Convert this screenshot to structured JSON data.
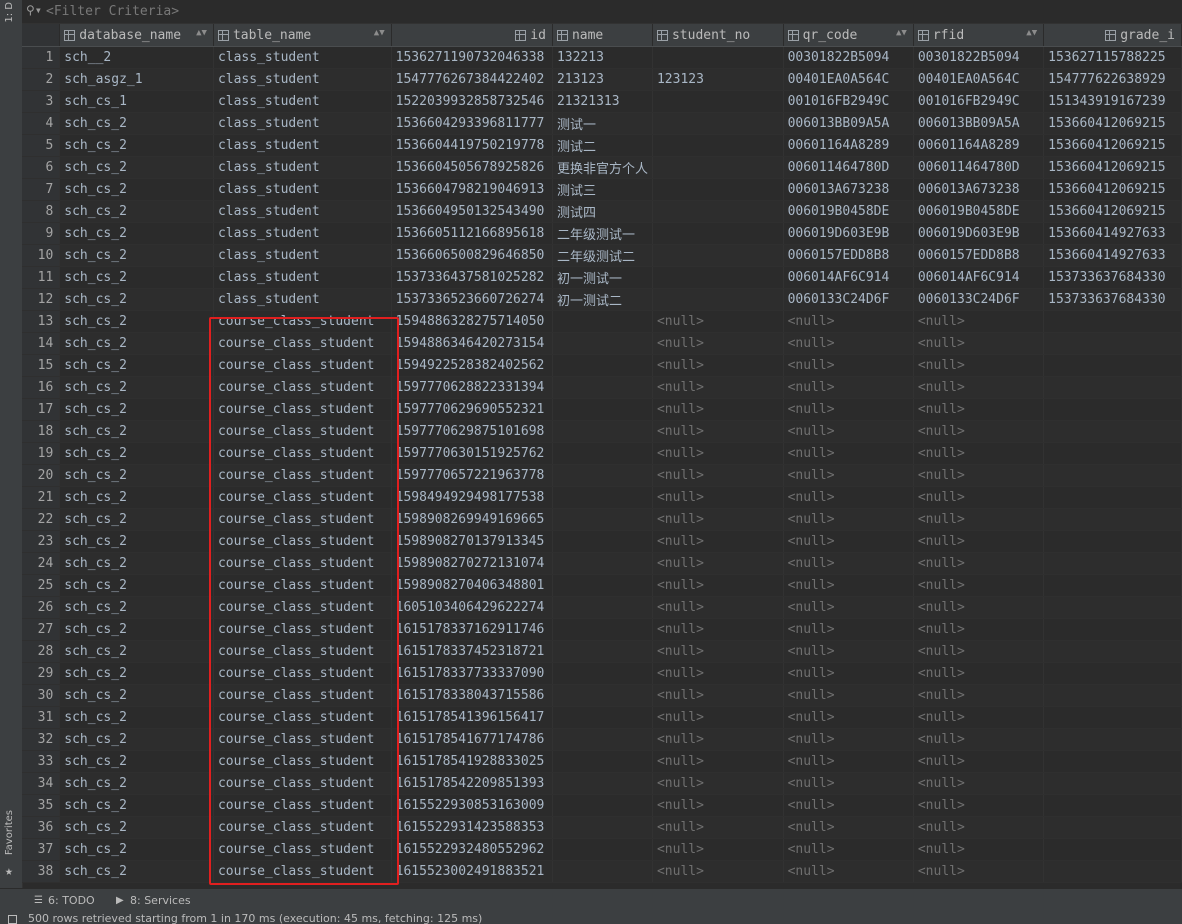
{
  "side_panels": {
    "database_label": "1: D",
    "favorites_label": "Favorites"
  },
  "filter": {
    "placeholder": "<Filter Criteria>"
  },
  "columns": [
    {
      "label": "database_name"
    },
    {
      "label": "table_name"
    },
    {
      "label": "id"
    },
    {
      "label": "name"
    },
    {
      "label": "student_no"
    },
    {
      "label": "qr_code"
    },
    {
      "label": "rfid"
    },
    {
      "label": "grade_i"
    }
  ],
  "rows": [
    [
      "1",
      "sch__2",
      "class_student",
      "1536271190732046338",
      "132213",
      "",
      "00301822B5094",
      "00301822B5094",
      "153627115788225"
    ],
    [
      "2",
      "sch_asgz_1",
      "class_student",
      "1547776267384422402",
      "213123",
      "123123",
      "00401EA0A564C",
      "00401EA0A564C",
      "154777622638929"
    ],
    [
      "3",
      "sch_cs_1",
      "class_student",
      "1522039932858732546",
      "21321313",
      "",
      "001016FB2949C",
      "001016FB2949C",
      "151343919167239"
    ],
    [
      "4",
      "sch_cs_2",
      "class_student",
      "1536604293396811777",
      "测试一",
      "",
      "006013BB09A5A",
      "006013BB09A5A",
      "153660412069215"
    ],
    [
      "5",
      "sch_cs_2",
      "class_student",
      "1536604419750219778",
      "测试二",
      "",
      "00601164A8289",
      "00601164A8289",
      "153660412069215"
    ],
    [
      "6",
      "sch_cs_2",
      "class_student",
      "1536604505678925826",
      "更换非官方个人",
      "",
      "006011464780D",
      "006011464780D",
      "153660412069215"
    ],
    [
      "7",
      "sch_cs_2",
      "class_student",
      "1536604798219046913",
      "测试三",
      "",
      "006013A673238",
      "006013A673238",
      "153660412069215"
    ],
    [
      "8",
      "sch_cs_2",
      "class_student",
      "1536604950132543490",
      "测试四",
      "",
      "006019B0458DE",
      "006019B0458DE",
      "153660412069215"
    ],
    [
      "9",
      "sch_cs_2",
      "class_student",
      "1536605112166895618",
      "二年级测试一",
      "",
      "006019D603E9B",
      "006019D603E9B",
      "153660414927633"
    ],
    [
      "10",
      "sch_cs_2",
      "class_student",
      "1536606500829646850",
      "二年级测试二",
      "",
      "0060157EDD8B8",
      "0060157EDD8B8",
      "153660414927633"
    ],
    [
      "11",
      "sch_cs_2",
      "class_student",
      "1537336437581025282",
      "初一测试一",
      "",
      "006014AF6C914",
      "006014AF6C914",
      "153733637684330"
    ],
    [
      "12",
      "sch_cs_2",
      "class_student",
      "1537336523660726274",
      "初一测试二",
      "",
      "0060133C24D6F",
      "0060133C24D6F",
      "153733637684330"
    ],
    [
      "13",
      "sch_cs_2",
      "course_class_student",
      "1594886328275714050",
      "",
      "<null>",
      "<null>",
      "<null>",
      ""
    ],
    [
      "14",
      "sch_cs_2",
      "course_class_student",
      "1594886346420273154",
      "",
      "<null>",
      "<null>",
      "<null>",
      ""
    ],
    [
      "15",
      "sch_cs_2",
      "course_class_student",
      "1594922528382402562",
      "",
      "<null>",
      "<null>",
      "<null>",
      ""
    ],
    [
      "16",
      "sch_cs_2",
      "course_class_student",
      "1597770628822331394",
      "",
      "<null>",
      "<null>",
      "<null>",
      ""
    ],
    [
      "17",
      "sch_cs_2",
      "course_class_student",
      "1597770629690552321",
      "",
      "<null>",
      "<null>",
      "<null>",
      ""
    ],
    [
      "18",
      "sch_cs_2",
      "course_class_student",
      "1597770629875101698",
      "",
      "<null>",
      "<null>",
      "<null>",
      ""
    ],
    [
      "19",
      "sch_cs_2",
      "course_class_student",
      "1597770630151925762",
      "",
      "<null>",
      "<null>",
      "<null>",
      ""
    ],
    [
      "20",
      "sch_cs_2",
      "course_class_student",
      "1597770657221963778",
      "",
      "<null>",
      "<null>",
      "<null>",
      ""
    ],
    [
      "21",
      "sch_cs_2",
      "course_class_student",
      "1598494929498177538",
      "",
      "<null>",
      "<null>",
      "<null>",
      ""
    ],
    [
      "22",
      "sch_cs_2",
      "course_class_student",
      "1598908269949169665",
      "",
      "<null>",
      "<null>",
      "<null>",
      ""
    ],
    [
      "23",
      "sch_cs_2",
      "course_class_student",
      "1598908270137913345",
      "",
      "<null>",
      "<null>",
      "<null>",
      ""
    ],
    [
      "24",
      "sch_cs_2",
      "course_class_student",
      "1598908270272131074",
      "",
      "<null>",
      "<null>",
      "<null>",
      ""
    ],
    [
      "25",
      "sch_cs_2",
      "course_class_student",
      "1598908270406348801",
      "",
      "<null>",
      "<null>",
      "<null>",
      ""
    ],
    [
      "26",
      "sch_cs_2",
      "course_class_student",
      "1605103406429622274",
      "",
      "<null>",
      "<null>",
      "<null>",
      ""
    ],
    [
      "27",
      "sch_cs_2",
      "course_class_student",
      "1615178337162911746",
      "",
      "<null>",
      "<null>",
      "<null>",
      ""
    ],
    [
      "28",
      "sch_cs_2",
      "course_class_student",
      "1615178337452318721",
      "",
      "<null>",
      "<null>",
      "<null>",
      ""
    ],
    [
      "29",
      "sch_cs_2",
      "course_class_student",
      "1615178337733337090",
      "",
      "<null>",
      "<null>",
      "<null>",
      ""
    ],
    [
      "30",
      "sch_cs_2",
      "course_class_student",
      "1615178338043715586",
      "",
      "<null>",
      "<null>",
      "<null>",
      ""
    ],
    [
      "31",
      "sch_cs_2",
      "course_class_student",
      "1615178541396156417",
      "",
      "<null>",
      "<null>",
      "<null>",
      ""
    ],
    [
      "32",
      "sch_cs_2",
      "course_class_student",
      "1615178541677174786",
      "",
      "<null>",
      "<null>",
      "<null>",
      ""
    ],
    [
      "33",
      "sch_cs_2",
      "course_class_student",
      "1615178541928833025",
      "",
      "<null>",
      "<null>",
      "<null>",
      ""
    ],
    [
      "34",
      "sch_cs_2",
      "course_class_student",
      "1615178542209851393",
      "",
      "<null>",
      "<null>",
      "<null>",
      ""
    ],
    [
      "35",
      "sch_cs_2",
      "course_class_student",
      "1615522930853163009",
      "",
      "<null>",
      "<null>",
      "<null>",
      ""
    ],
    [
      "36",
      "sch_cs_2",
      "course_class_student",
      "1615522931423588353",
      "",
      "<null>",
      "<null>",
      "<null>",
      ""
    ],
    [
      "37",
      "sch_cs_2",
      "course_class_student",
      "1615522932480552962",
      "",
      "<null>",
      "<null>",
      "<null>",
      ""
    ],
    [
      "38",
      "sch_cs_2",
      "course_class_student",
      "1615523002491883521",
      "",
      "<null>",
      "<null>",
      "<null>",
      ""
    ]
  ],
  "toolbar": {
    "todo_label": "6: TODO",
    "services_label": "8: Services"
  },
  "status": {
    "text": "500 rows retrieved starting from 1 in 170 ms (execution: 45 ms, fetching: 125 ms)"
  },
  "colors": {
    "background": "#2b2b2b",
    "header_bg": "#3c3f41",
    "null_text": "#6f6f6f",
    "highlight": "#e01f1f"
  }
}
